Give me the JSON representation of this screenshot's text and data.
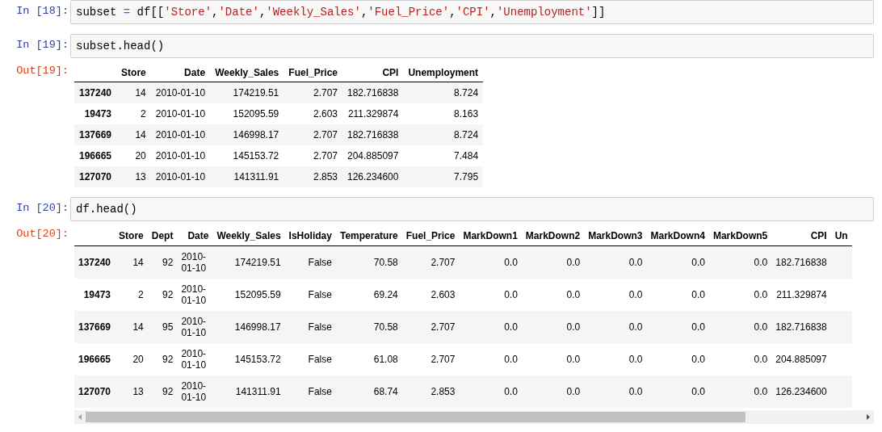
{
  "cells": [
    {
      "prompt": "In [18]:",
      "code": [
        {
          "text": "subset ",
          "kind": "name"
        },
        {
          "text": "=",
          "kind": "operator"
        },
        {
          "text": " df[[",
          "kind": "name"
        },
        {
          "text": "'Store'",
          "kind": "string"
        },
        {
          "text": ",",
          "kind": "name"
        },
        {
          "text": "'Date'",
          "kind": "string"
        },
        {
          "text": ",",
          "kind": "name"
        },
        {
          "text": "'Weekly_Sales'",
          "kind": "string"
        },
        {
          "text": ",",
          "kind": "name"
        },
        {
          "text": "'Fuel_Price'",
          "kind": "string"
        },
        {
          "text": ",",
          "kind": "name"
        },
        {
          "text": "'CPI'",
          "kind": "string"
        },
        {
          "text": ",",
          "kind": "name"
        },
        {
          "text": "'Unemployment'",
          "kind": "string"
        },
        {
          "text": "]]",
          "kind": "name"
        }
      ]
    },
    {
      "prompt": "In [19]:",
      "code": [
        {
          "text": "subset.head()",
          "kind": "name"
        }
      ],
      "output": {
        "prompt": "Out[19]:",
        "horizontal_scroll": false,
        "columns": [
          {
            "label": "Store",
            "kind": "number"
          },
          {
            "label": "Date",
            "kind": "date"
          },
          {
            "label": "Weekly_Sales",
            "kind": "number"
          },
          {
            "label": "Fuel_Price",
            "kind": "number"
          },
          {
            "label": "CPI",
            "kind": "number"
          },
          {
            "label": "Unemployment",
            "kind": "number"
          }
        ],
        "rows": [
          {
            "index": "137240",
            "cells": [
              "14",
              "2010-01-10",
              "174219.51",
              "2.707",
              "182.716838",
              "8.724"
            ]
          },
          {
            "index": "19473",
            "cells": [
              "2",
              "2010-01-10",
              "152095.59",
              "2.603",
              "211.329874",
              "8.163"
            ]
          },
          {
            "index": "137669",
            "cells": [
              "14",
              "2010-01-10",
              "146998.17",
              "2.707",
              "182.716838",
              "8.724"
            ]
          },
          {
            "index": "196665",
            "cells": [
              "20",
              "2010-01-10",
              "145153.72",
              "2.707",
              "204.885097",
              "7.484"
            ]
          },
          {
            "index": "127070",
            "cells": [
              "13",
              "2010-01-10",
              "141311.91",
              "2.853",
              "126.234600",
              "7.795"
            ]
          }
        ]
      }
    },
    {
      "prompt": "In [20]:",
      "code": [
        {
          "text": "df.head()",
          "kind": "name"
        }
      ],
      "output": {
        "prompt": "Out[20]:",
        "horizontal_scroll": true,
        "columns": [
          {
            "label": "Store",
            "kind": "number"
          },
          {
            "label": "Dept",
            "kind": "number"
          },
          {
            "label": "Date",
            "kind": "date"
          },
          {
            "label": "Weekly_Sales",
            "kind": "number"
          },
          {
            "label": "IsHoliday",
            "kind": "number"
          },
          {
            "label": "Temperature",
            "kind": "number"
          },
          {
            "label": "Fuel_Price",
            "kind": "number"
          },
          {
            "label": "MarkDown1",
            "kind": "number"
          },
          {
            "label": "MarkDown2",
            "kind": "number"
          },
          {
            "label": "MarkDown3",
            "kind": "number"
          },
          {
            "label": "MarkDown4",
            "kind": "number"
          },
          {
            "label": "MarkDown5",
            "kind": "number"
          },
          {
            "label": "CPI",
            "kind": "number"
          },
          {
            "label": "Un"
          }
        ],
        "rows": [
          {
            "index": "137240",
            "cells": [
              "14",
              "92",
              "2010-01-10",
              "174219.51",
              "False",
              "70.58",
              "2.707",
              "0.0",
              "0.0",
              "0.0",
              "0.0",
              "0.0",
              "182.716838"
            ]
          },
          {
            "index": "19473",
            "cells": [
              "2",
              "92",
              "2010-01-10",
              "152095.59",
              "False",
              "69.24",
              "2.603",
              "0.0",
              "0.0",
              "0.0",
              "0.0",
              "0.0",
              "211.329874"
            ]
          },
          {
            "index": "137669",
            "cells": [
              "14",
              "95",
              "2010-01-10",
              "146998.17",
              "False",
              "70.58",
              "2.707",
              "0.0",
              "0.0",
              "0.0",
              "0.0",
              "0.0",
              "182.716838"
            ]
          },
          {
            "index": "196665",
            "cells": [
              "20",
              "92",
              "2010-01-10",
              "145153.72",
              "False",
              "61.08",
              "2.707",
              "0.0",
              "0.0",
              "0.0",
              "0.0",
              "0.0",
              "204.885097"
            ]
          },
          {
            "index": "127070",
            "cells": [
              "13",
              "92",
              "2010-01-10",
              "141311.91",
              "False",
              "68.74",
              "2.853",
              "0.0",
              "0.0",
              "0.0",
              "0.0",
              "0.0",
              "126.234600"
            ]
          }
        ]
      }
    }
  ]
}
